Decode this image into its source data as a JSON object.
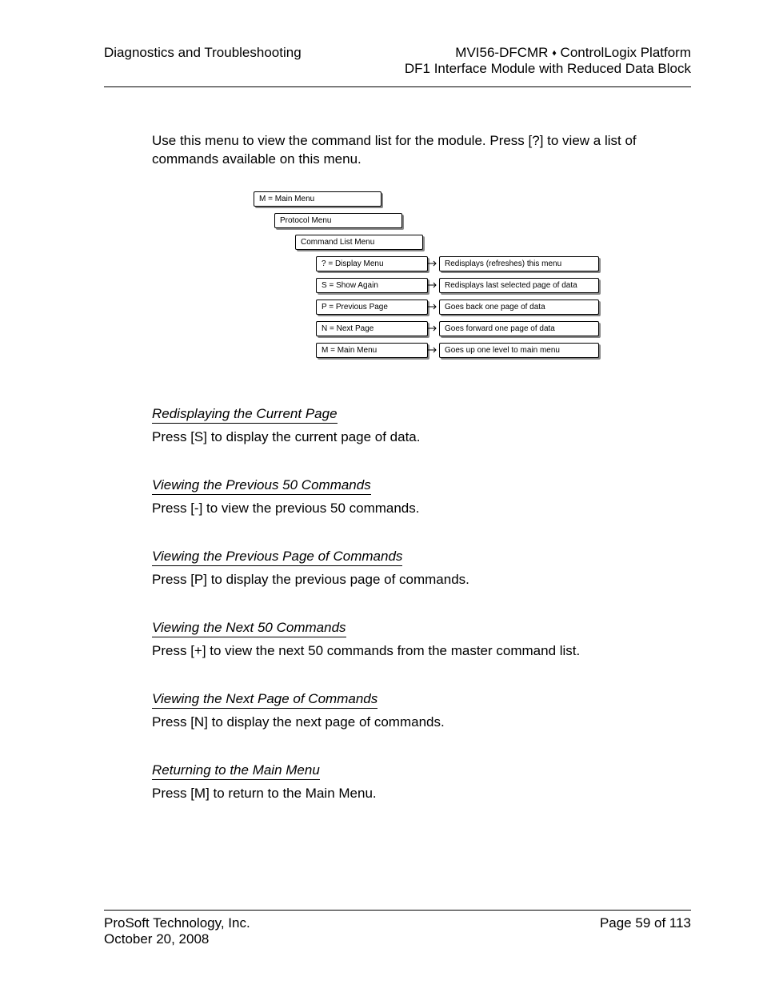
{
  "header": {
    "left": "Diagnostics and Troubleshooting",
    "right_line1_a": "MVI56-DFCMR ",
    "right_line1_sep": "♦",
    "right_line1_b": " ControlLogix Platform",
    "right_line2": "DF1 Interface Module with Reduced Data Block"
  },
  "intro": {
    "pre": "Use this menu to view the command list for the module. Press ",
    "key": "[?]",
    "post": " to view a list of commands available on this menu."
  },
  "diagram": {
    "lvl0": "M = Main Menu",
    "lvl1": "Protocol Menu",
    "lvl2": "Command List Menu",
    "rows": [
      {
        "cmd": "? = Display Menu",
        "desc": "Redisplays (refreshes) this menu"
      },
      {
        "cmd": "S = Show Again",
        "desc": "Redisplays last selected page of data"
      },
      {
        "cmd": "P = Previous Page",
        "desc": "Goes back one page of data"
      },
      {
        "cmd": "N = Next Page",
        "desc": "Goes forward one page of data"
      },
      {
        "cmd": "M = Main Menu",
        "desc": "Goes up one level to main menu"
      }
    ]
  },
  "sections": [
    {
      "heading": "Redisplaying the Current Page",
      "pre": "Press ",
      "key": "[S]",
      "post": " to display the current page of data."
    },
    {
      "heading": "Viewing the Previous 50 Commands",
      "pre": "Press ",
      "key": "[-]",
      "post": " to view the previous 50 commands."
    },
    {
      "heading": "Viewing the Previous Page of Commands",
      "pre": "Press ",
      "key": "[P]",
      "post": " to display the previous page of commands."
    },
    {
      "heading": "Viewing the Next 50 Commands",
      "pre": "Press ",
      "key": "[+]",
      "post": " to view the next 50 commands from the master command list."
    },
    {
      "heading": "Viewing the Next Page of Commands",
      "pre": "Press ",
      "key": "[N]",
      "post": " to display the next page of commands."
    },
    {
      "heading": "Returning to the Main Menu",
      "pre": "Press ",
      "key": "[M]",
      "post": " to return to the Main Menu."
    }
  ],
  "footer": {
    "company": "ProSoft Technology, Inc.",
    "date": "October 20, 2008",
    "page": "Page 59 of 113"
  }
}
